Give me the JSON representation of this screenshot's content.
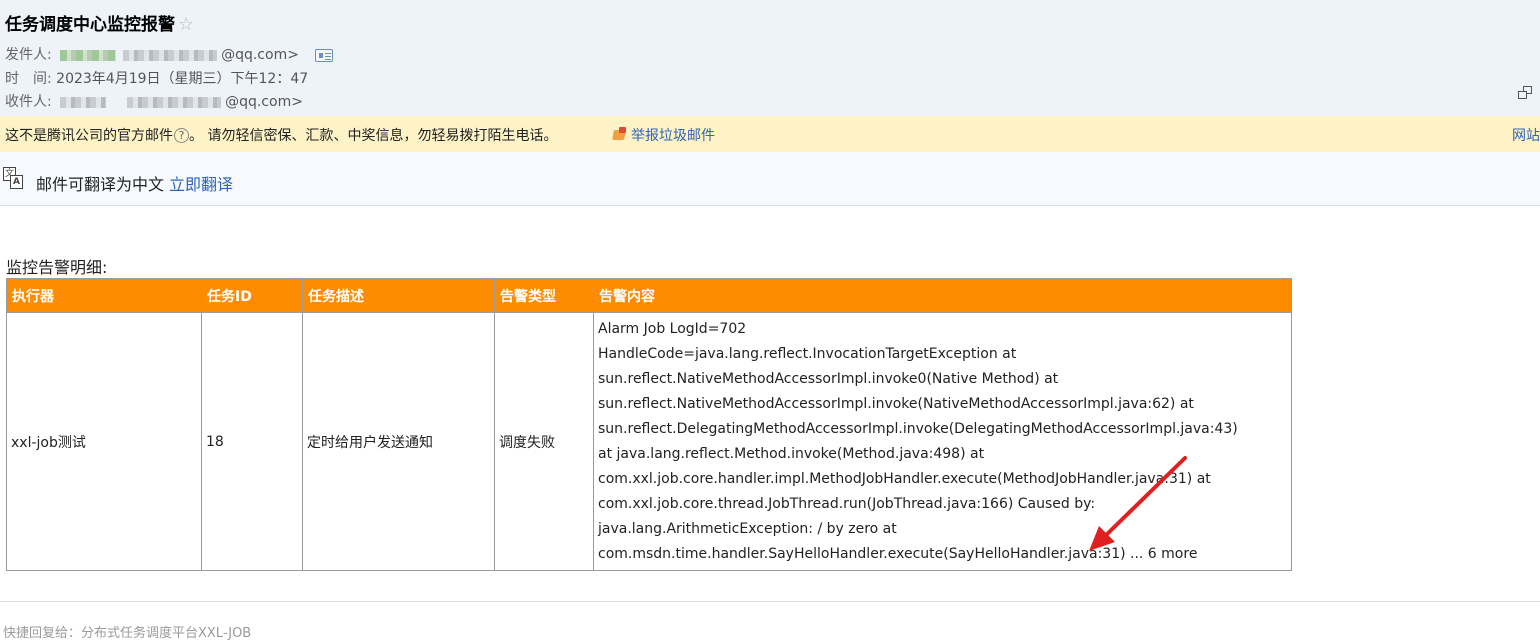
{
  "header": {
    "subject": "任务调度中心监控报警",
    "star": "☆",
    "sender_label": "发件人:",
    "sender_suffix": "@qq.com>",
    "time_label": "时　间:",
    "time_value": "2023年4月19日（星期三）下午12：47",
    "recipient_label": "收件人:",
    "recipient_suffix": "@qq.com>"
  },
  "warning": {
    "text_prefix": "这不是腾讯公司的官方邮件",
    "qmark": "?",
    "text_suffix": "。 请勿轻信密保、汇款、中奖信息，勿轻易拨打陌生电话。",
    "report_link": "举报垃圾邮件",
    "site_link": "网站"
  },
  "translate": {
    "icon_a": "文",
    "icon_b": "A",
    "text": "邮件可翻译为中文",
    "link": "立即翻译"
  },
  "detail": {
    "title": "监控告警明细:",
    "columns": [
      "执行器",
      "任务ID",
      "任务描述",
      "告警类型",
      "告警内容"
    ],
    "row": {
      "executor": "xxl-job测试",
      "task_id": "18",
      "task_desc": "定时给用户发送通知",
      "alarm_type": "调度失败",
      "content_lines": [
        "Alarm Job LogId=702",
        "HandleCode=java.lang.reflect.InvocationTargetException at",
        "sun.reflect.NativeMethodAccessorImpl.invoke0(Native Method) at",
        "sun.reflect.NativeMethodAccessorImpl.invoke(NativeMethodAccessorImpl.java:62) at",
        "sun.reflect.DelegatingMethodAccessorImpl.invoke(DelegatingMethodAccessorImpl.java:43)",
        "at java.lang.reflect.Method.invoke(Method.java:498) at",
        "com.xxl.job.core.handler.impl.MethodJobHandler.execute(MethodJobHandler.java:31) at",
        "com.xxl.job.core.thread.JobThread.run(JobThread.java:166) Caused by:",
        "java.lang.ArithmeticException: / by zero at",
        "com.msdn.time.handler.SayHelloHandler.execute(SayHelloHandler.java:31) ... 6 more"
      ]
    }
  },
  "footer": {
    "quick_reply": "快捷回复给：分布式任务调度平台XXL-JOB"
  },
  "colors": {
    "table_header": "#ff8c00",
    "link": "#2f64b8",
    "arrow": "#e02020",
    "warning_bg": "#fdf3c6"
  }
}
